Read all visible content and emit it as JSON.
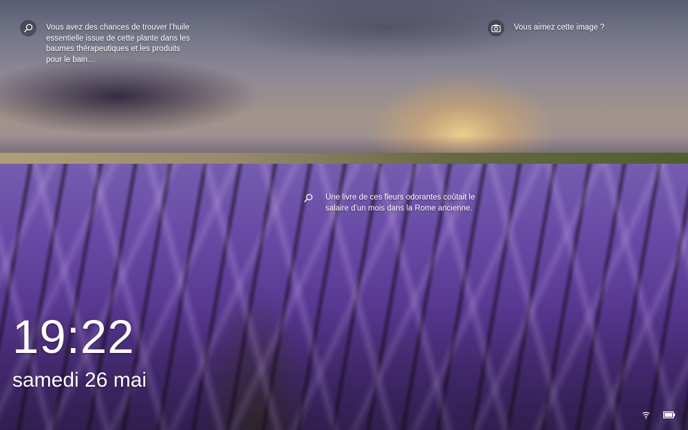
{
  "hotspots": [
    {
      "icon": "search-icon",
      "text": "Vous avez des chances de trouver l’huile essentielle issue de cette plante dans les baumes thérapeutiques et les produits pour le bain…"
    },
    {
      "icon": "camera-icon",
      "text": "Vous aimez cette image ?"
    },
    {
      "icon": "search-icon",
      "text": "Une livre de ces fleurs odorantes coûtait le salaire d’un mois dans la Rome ancienne."
    }
  ],
  "clock": {
    "time": "19:22",
    "date": "samedi 26 mai"
  },
  "status": {
    "network_icon": "network-icon",
    "battery_icon": "battery-icon"
  },
  "colors": {
    "text": "#ffffff",
    "lavender": "#6f4fb0",
    "sky": "#9699b1",
    "sun": "#ffe296"
  }
}
